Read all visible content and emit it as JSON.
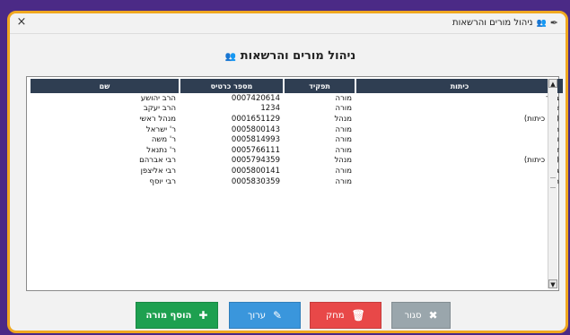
{
  "window": {
    "title": "ניהול מורים והרשאות",
    "close_glyph": "×"
  },
  "header": {
    "title": "ניהול מורים והרשאות"
  },
  "table": {
    "columns": [
      "כיתות",
      "תפקיד",
      "מספר כרטיס",
      "שם"
    ],
    "rows": [
      {
        "classes": "ב, ד",
        "role": "מורה",
        "card": "0007420614",
        "name": "הרב יהושע"
      },
      {
        "classes": "א",
        "role": "מורה",
        "card": "1234",
        "name": "הרב יעקב"
      },
      {
        "classes": "(אין כיתות)",
        "role": "מנהל",
        "card": "0001651129",
        "name": "מנהל ראשי"
      },
      {
        "classes": "ה",
        "role": "מורה",
        "card": "0005800143",
        "name": "ר' ישראל"
      },
      {
        "classes": "ו",
        "role": "מורה",
        "card": "0005814993",
        "name": "ר' משה"
      },
      {
        "classes": "ז",
        "role": "מורה",
        "card": "0005766111",
        "name": "ר' נתנאל"
      },
      {
        "classes": "(אין כיתות)",
        "role": "מנהל",
        "card": "0005794359",
        "name": "רבי אברהם"
      },
      {
        "classes": "ג",
        "role": "מורה",
        "card": "0005800141",
        "name": "רבי אליצפן"
      },
      {
        "classes": "ח",
        "role": "מורה",
        "card": "0005830359",
        "name": "רבי יוסף"
      }
    ]
  },
  "buttons": {
    "close": "סגור",
    "delete": "מחק",
    "edit": "ערוך",
    "add": "הוסף מורה"
  },
  "icons": {
    "feather": "feather-icon",
    "people": "people-icon",
    "close": "x-icon",
    "trash": "trash-icon",
    "pencil": "pencil-icon",
    "plus": "plus-icon"
  },
  "colors": {
    "frame": "#f0a820",
    "table_header": "#2f3e52",
    "add": "#1ea050",
    "edit": "#3a96dc",
    "delete": "#e84848",
    "close": "#9aa6ac"
  }
}
